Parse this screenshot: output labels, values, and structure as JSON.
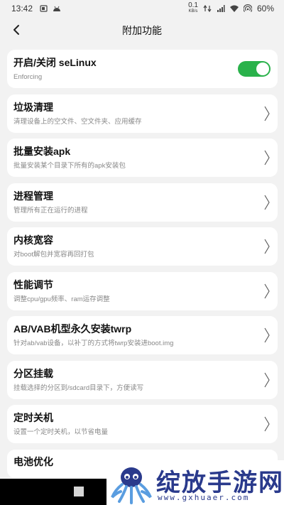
{
  "status_bar": {
    "time": "13:42",
    "net_speed_value": "0.1",
    "net_speed_unit": "KB/s",
    "battery": "60%",
    "icons": [
      "sim-icon",
      "android-icon",
      "data-arrows-icon",
      "signal-icon",
      "wifi-icon",
      "hotspot-icon"
    ]
  },
  "header": {
    "title": "附加功能",
    "back_icon": "chevron-left-icon"
  },
  "toggle_item": {
    "title": "开启/关闭 seLinux",
    "desc": "Enforcing",
    "enabled": true,
    "color": "#2ab24b"
  },
  "items": [
    {
      "title": "垃圾清理",
      "desc": "清理设备上的空文件、空文件夹、应用缓存"
    },
    {
      "title": "批量安装apk",
      "desc": "批量安装某个目录下所有的apk安装包"
    },
    {
      "title": "进程管理",
      "desc": "管理所有正在运行的进程"
    },
    {
      "title": "内核宽容",
      "desc": "对boot解包并宽容再回打包"
    },
    {
      "title": "性能调节",
      "desc": "调整cpu/gpu频率、ram运存调整"
    },
    {
      "title": "AB/VAB机型永久安装twrp",
      "desc": "针对ab/vab设备，以补丁的方式将twrp安装进boot.img"
    },
    {
      "title": "分区挂载",
      "desc": "挂载选择的分区到/sdcard目录下，方便读写"
    },
    {
      "title": "定时关机",
      "desc": "设置一个定时关机，以节省电量"
    }
  ],
  "partial_item": {
    "title": "电池优化"
  },
  "watermark": {
    "title": "绽放手游网",
    "url": "www.gxhuaer.com"
  }
}
